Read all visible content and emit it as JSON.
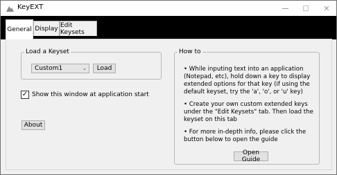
{
  "window": {
    "title": "KeyEXT",
    "icon": "app-icon",
    "controls": [
      "minimize-icon",
      "maximize-icon",
      "close-icon"
    ]
  },
  "tabs": [
    {
      "label": "General",
      "active": true
    },
    {
      "label": "Display",
      "active": false
    },
    {
      "label": "Edit Keysets",
      "active": false
    }
  ],
  "load_keyset": {
    "legend": "Load a Keyset",
    "selected": "Custom1",
    "load_label": "Load"
  },
  "startup": {
    "label": "Show this window at application start",
    "checked": true
  },
  "about_label": "About",
  "howto": {
    "legend": "How to",
    "paragraphs": [
      "• While inputing text into an application (Notepad, etc), hold down a key to display extended options for that key (if using the default keyset, try the 'a', 'o', or 'u' key)",
      "• Create your own custom extended keys under the \"Edit Keysets\" tab.  Then load the keyset on this tab",
      "• For more in-depth info, please click the button below to open the guide"
    ],
    "guide_label": "Open Guide"
  }
}
